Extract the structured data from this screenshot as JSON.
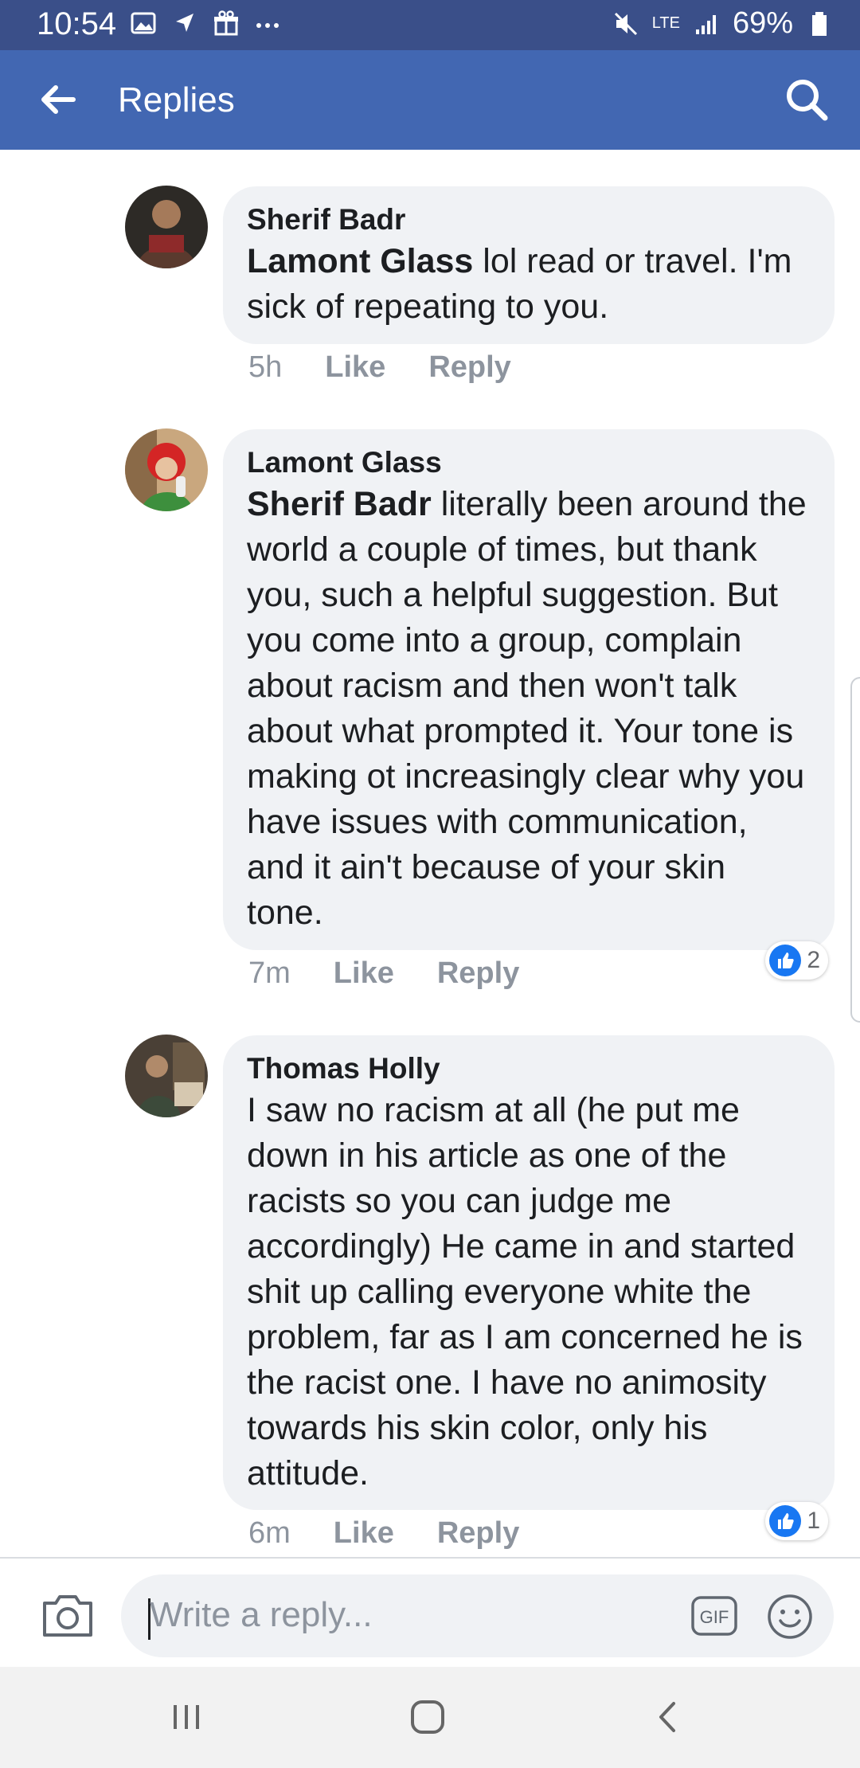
{
  "status_bar": {
    "time": "10:54",
    "network": "LTE",
    "battery": "69%"
  },
  "app_bar": {
    "title": "Replies"
  },
  "comments": [
    {
      "author": "Sherif Badr",
      "mention": "Lamont Glass",
      "text": " lol read or travel. I'm sick of repeating to you.",
      "time": "5h",
      "like_label": "Like",
      "reply_label": "Reply",
      "reaction_count": null
    },
    {
      "author": "Lamont Glass",
      "mention": "Sherif Badr",
      "text": " literally been around the world a couple of times, but thank you, such a helpful suggestion.  But you come into a group, complain about racism and then won't talk about what prompted it.  Your tone is making ot increasingly clear why you have issues with communication, and it ain't because of your skin tone.",
      "time": "7m",
      "like_label": "Like",
      "reply_label": "Reply",
      "reaction_count": "2"
    },
    {
      "author": "Thomas Holly",
      "mention": "",
      "text": "I saw no racism at all (he put me down in his article as one of the racists so you can judge me accordingly) He came in and started shit up calling everyone white the problem, far as I am concerned he is the racist one. I have no animosity towards his skin color, only his attitude.",
      "time": "6m",
      "like_label": "Like",
      "reply_label": "Reply",
      "reaction_count": "1"
    }
  ],
  "composer": {
    "placeholder": "Write a reply..."
  },
  "colors": {
    "status_bar": "#3a4f89",
    "app_bar": "#4267b2",
    "bubble": "#f0f2f5",
    "like_blue": "#1877f2"
  }
}
